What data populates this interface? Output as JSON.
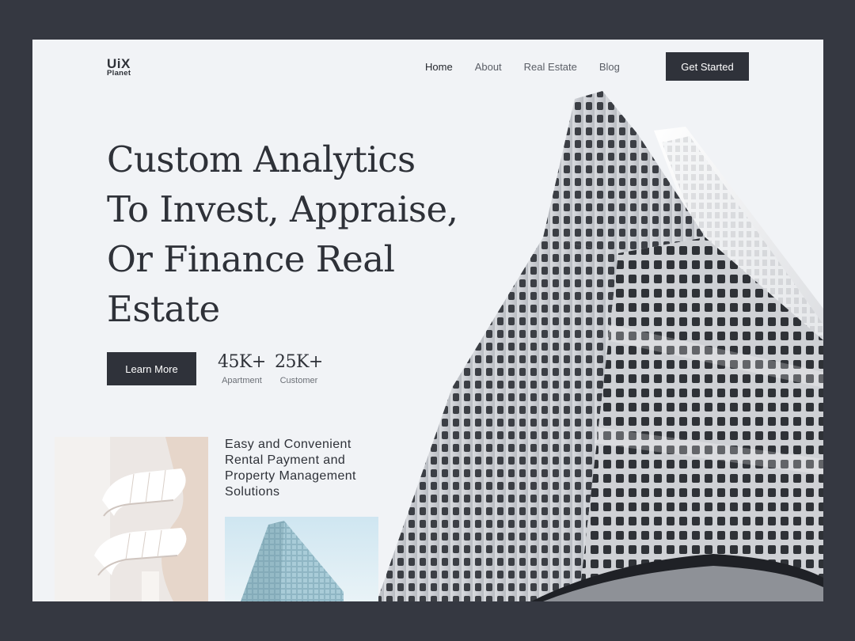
{
  "brand": {
    "name": "UiX",
    "sub": "Planet"
  },
  "nav": {
    "items": [
      {
        "label": "Home",
        "active": true
      },
      {
        "label": "About",
        "active": false
      },
      {
        "label": "Real Estate",
        "active": false
      },
      {
        "label": "Blog",
        "active": false
      }
    ],
    "cta_label": "Get Started"
  },
  "hero": {
    "headline_lines": [
      "Custom Analytics",
      "To Invest, Appraise,",
      "Or Finance Real",
      "Estate"
    ],
    "learn_more_label": "Learn More",
    "stats": [
      {
        "value": "45K+",
        "label": "Apartment"
      },
      {
        "value": "25K+",
        "label": "Customer"
      }
    ]
  },
  "feature": {
    "text_lines": [
      "Easy and Convenient",
      "Rental Payment and",
      "Property Management",
      "Solutions"
    ]
  },
  "colors": {
    "background": "#353841",
    "card": "#f1f3f6",
    "dark": "#2f323a",
    "text": "#2e3138"
  }
}
